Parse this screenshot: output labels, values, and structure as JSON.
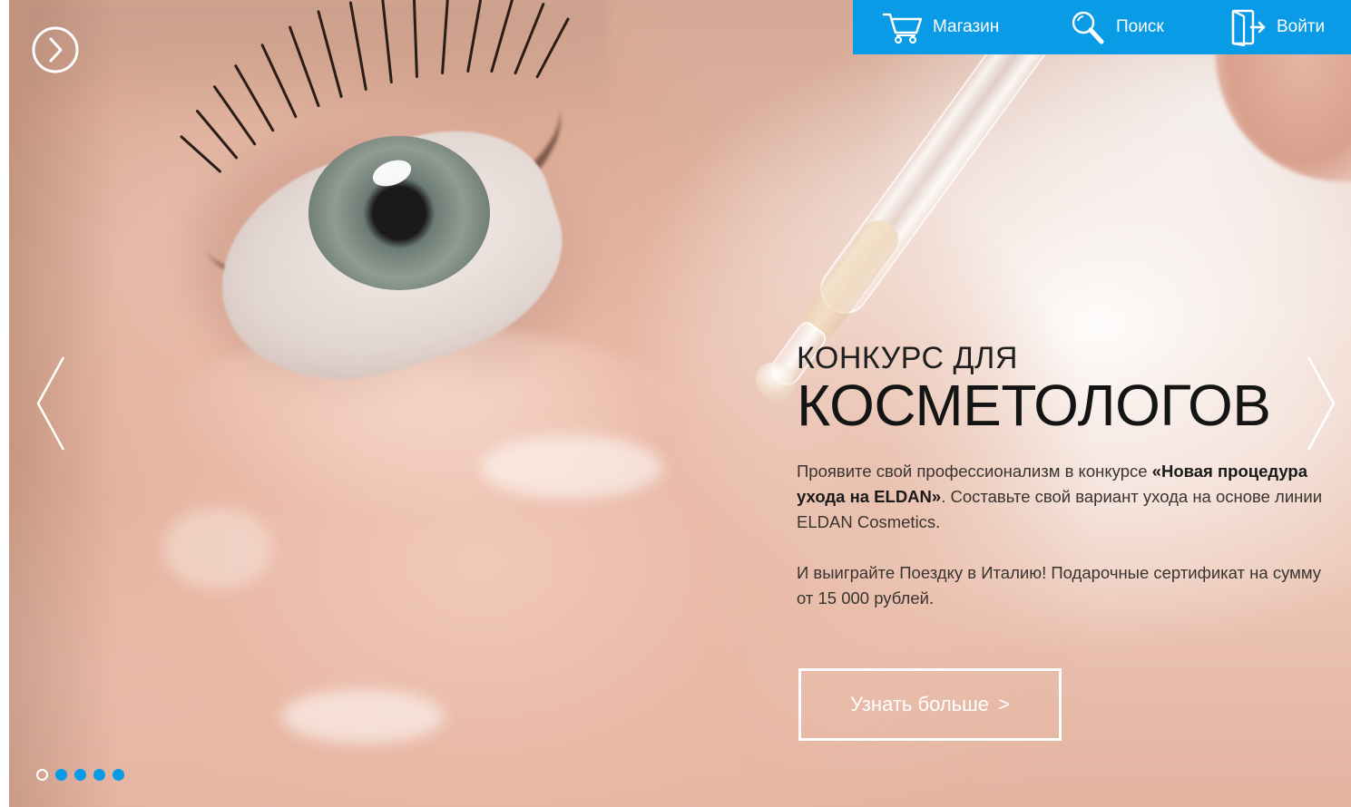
{
  "nav": {
    "shop_label": "Магазин",
    "search_label": "Поиск",
    "login_label": "Войти"
  },
  "icons": {
    "menu": "chevron-right-circle-icon",
    "shop": "cart-icon",
    "search": "search-icon",
    "login": "login-door-icon",
    "prev": "chevron-left-icon",
    "next": "chevron-right-icon"
  },
  "promo": {
    "pre_title": "КОНКУРС ДЛЯ",
    "title": "КОСМЕТОЛОГОВ",
    "text1_start": "Проявите свой профессионализм в конкурсе ",
    "text1_bold": "«Новая процедура ухода на ELDAN»",
    "text1_end": ". Составьте свой вариант ухода на основе линии ELDAN Cosmetics.",
    "text2": "И выиграйте Поездку в Италию! Подарочные сертификат на сумму от 15 000 рублей.",
    "cta_label": "Узнать больше",
    "cta_chevron": ">"
  },
  "slider": {
    "total_slides": 5,
    "active_slide": 1
  },
  "colors": {
    "accent": "#0a9be6",
    "text": "#1e1e1e",
    "white": "#ffffff"
  }
}
